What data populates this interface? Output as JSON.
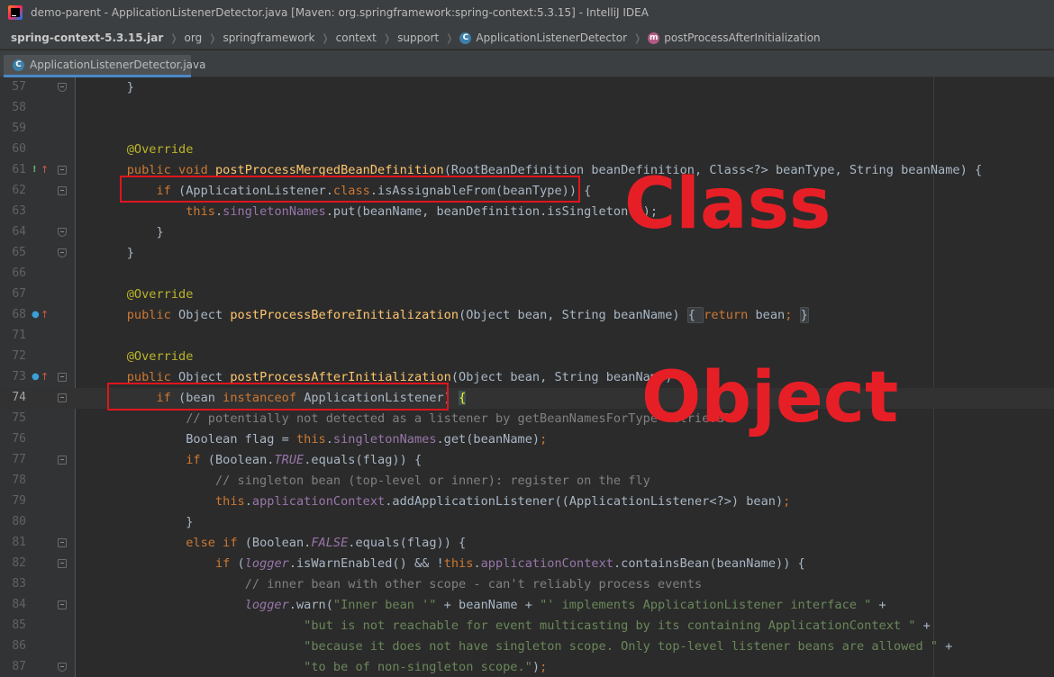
{
  "window": {
    "title": "demo-parent - ApplicationListenerDetector.java [Maven: org.springframework:spring-context:5.3.15] - IntelliJ IDEA"
  },
  "breadcrumbs": [
    {
      "label": "spring-context-5.3.15.jar",
      "icon": "jar"
    },
    {
      "label": "org",
      "icon": "none"
    },
    {
      "label": "springframework",
      "icon": "none"
    },
    {
      "label": "context",
      "icon": "none"
    },
    {
      "label": "support",
      "icon": "none"
    },
    {
      "label": "ApplicationListenerDetector",
      "icon": "class-icon"
    },
    {
      "label": "postProcessAfterInitialization",
      "icon": "method-icon"
    }
  ],
  "tab": {
    "label": "ApplicationListenerDetector.java",
    "icon": "class-icon"
  },
  "editor": {
    "current_line": "74",
    "lines": [
      {
        "n": "57",
        "gutter": "",
        "fold": "end",
        "segs": [
          [
            "    }",
            ""
          ]
        ]
      },
      {
        "n": "58",
        "gutter": "",
        "fold": "",
        "segs": []
      },
      {
        "n": "59",
        "gutter": "",
        "fold": "",
        "segs": []
      },
      {
        "n": "60",
        "gutter": "",
        "fold": "",
        "segs": [
          [
            "    ",
            ""
          ],
          [
            "@Override",
            "an"
          ]
        ]
      },
      {
        "n": "61",
        "gutter": "override-warn",
        "fold": "start",
        "segs": [
          [
            "    ",
            ""
          ],
          [
            "public void ",
            "kw"
          ],
          [
            "postProcessMergedBeanDefinition",
            "fn"
          ],
          [
            "(RootBeanDefinition beanDefinition, Class<?> beanType, String beanName) {",
            ""
          ]
        ]
      },
      {
        "n": "62",
        "gutter": "",
        "fold": "start",
        "segs": [
          [
            "        ",
            ""
          ],
          [
            "if ",
            "kw"
          ],
          [
            "(ApplicationListener.",
            ""
          ],
          [
            "class",
            "kw"
          ],
          [
            ".isAssignableFrom(beanType)) {",
            ""
          ]
        ]
      },
      {
        "n": "63",
        "gutter": "",
        "fold": "",
        "segs": [
          [
            "            ",
            ""
          ],
          [
            "this",
            "kw"
          ],
          [
            ".",
            ""
          ],
          [
            "singletonNames",
            "fd"
          ],
          [
            ".put(beanName, beanDefinition.isSingleton());",
            ""
          ]
        ]
      },
      {
        "n": "64",
        "gutter": "",
        "fold": "end",
        "segs": [
          [
            "        }",
            ""
          ]
        ]
      },
      {
        "n": "65",
        "gutter": "",
        "fold": "end",
        "segs": [
          [
            "    }",
            ""
          ]
        ]
      },
      {
        "n": "66",
        "gutter": "",
        "fold": "",
        "segs": []
      },
      {
        "n": "67",
        "gutter": "",
        "fold": "",
        "segs": [
          [
            "    ",
            ""
          ],
          [
            "@Override",
            "an"
          ]
        ]
      },
      {
        "n": "68",
        "gutter": "override",
        "fold": "",
        "segs": [
          [
            "    ",
            ""
          ],
          [
            "public ",
            "kw"
          ],
          [
            "Object ",
            ""
          ],
          [
            "postProcessBeforeInitialization",
            "fn"
          ],
          [
            "(Object bean, String beanName)",
            ""
          ],
          [
            " ",
            ""
          ],
          [
            "{ ",
            "fold-box"
          ],
          [
            "return ",
            "kw"
          ],
          [
            "bean",
            ""
          ],
          [
            "; ",
            "kw"
          ],
          [
            "}",
            "fold-box"
          ]
        ]
      },
      {
        "n": "71",
        "gutter": "",
        "fold": "",
        "segs": []
      },
      {
        "n": "72",
        "gutter": "",
        "fold": "",
        "segs": [
          [
            "    ",
            ""
          ],
          [
            "@Override",
            "an"
          ]
        ]
      },
      {
        "n": "73",
        "gutter": "override",
        "fold": "start",
        "segs": [
          [
            "    ",
            ""
          ],
          [
            "public ",
            "kw"
          ],
          [
            "Object ",
            ""
          ],
          [
            "postProcessAfterInitialization",
            "fn"
          ],
          [
            "(Object bean, String beanName) {",
            ""
          ]
        ]
      },
      {
        "n": "74",
        "gutter": "",
        "fold": "start",
        "segs": [
          [
            "        ",
            ""
          ],
          [
            "if ",
            "kw"
          ],
          [
            "(bean ",
            ""
          ],
          [
            "instanceof ",
            "kw"
          ],
          [
            "ApplicationListener) ",
            ""
          ],
          [
            "{",
            "brace-hl"
          ]
        ]
      },
      {
        "n": "75",
        "gutter": "",
        "fold": "",
        "segs": [
          [
            "            ",
            ""
          ],
          [
            "// potentially not detected as a listener by getBeanNamesForType retrieval",
            "cm"
          ]
        ]
      },
      {
        "n": "76",
        "gutter": "",
        "fold": "",
        "segs": [
          [
            "            Boolean flag = ",
            ""
          ],
          [
            "this",
            "kw"
          ],
          [
            ".",
            ""
          ],
          [
            "singletonNames",
            "fd"
          ],
          [
            ".get(beanName)",
            ""
          ],
          [
            ";",
            "kw"
          ]
        ]
      },
      {
        "n": "77",
        "gutter": "",
        "fold": "start",
        "segs": [
          [
            "            ",
            ""
          ],
          [
            "if ",
            "kw"
          ],
          [
            "(Boolean.",
            ""
          ],
          [
            "TRUE",
            "fd it"
          ],
          [
            ".equals(flag)) {",
            ""
          ]
        ]
      },
      {
        "n": "78",
        "gutter": "",
        "fold": "",
        "segs": [
          [
            "                ",
            ""
          ],
          [
            "// singleton bean (top-level or inner): register on the fly",
            "cm"
          ]
        ]
      },
      {
        "n": "79",
        "gutter": "",
        "fold": "",
        "segs": [
          [
            "                ",
            ""
          ],
          [
            "this",
            "kw"
          ],
          [
            ".",
            ""
          ],
          [
            "applicationContext",
            "fd"
          ],
          [
            ".addApplicationListener((ApplicationListener<?>) bean)",
            ""
          ],
          [
            ";",
            "kw"
          ]
        ]
      },
      {
        "n": "80",
        "gutter": "",
        "fold": "",
        "segs": [
          [
            "            }",
            ""
          ]
        ]
      },
      {
        "n": "81",
        "gutter": "",
        "fold": "start",
        "segs": [
          [
            "            ",
            ""
          ],
          [
            "else if ",
            "kw"
          ],
          [
            "(Boolean.",
            ""
          ],
          [
            "FALSE",
            "fd it"
          ],
          [
            ".equals(flag)) {",
            ""
          ]
        ]
      },
      {
        "n": "82",
        "gutter": "",
        "fold": "start",
        "segs": [
          [
            "                ",
            ""
          ],
          [
            "if ",
            "kw"
          ],
          [
            "(",
            ""
          ],
          [
            "logger",
            "fd it"
          ],
          [
            ".isWarnEnabled() && !",
            ""
          ],
          [
            "this",
            "kw"
          ],
          [
            ".",
            ""
          ],
          [
            "applicationContext",
            "fd"
          ],
          [
            ".containsBean(beanName)) {",
            ""
          ]
        ]
      },
      {
        "n": "83",
        "gutter": "",
        "fold": "",
        "segs": [
          [
            "                    ",
            ""
          ],
          [
            "// inner bean with other scope - can't reliably process events",
            "cm"
          ]
        ]
      },
      {
        "n": "84",
        "gutter": "",
        "fold": "start",
        "segs": [
          [
            "                    ",
            ""
          ],
          [
            "logger",
            "fd it"
          ],
          [
            ".warn(",
            ""
          ],
          [
            "\"Inner bean '\"",
            "str"
          ],
          [
            " + beanName + ",
            ""
          ],
          [
            "\"' implements ApplicationListener interface \"",
            "str"
          ],
          [
            " +",
            ""
          ]
        ]
      },
      {
        "n": "85",
        "gutter": "",
        "fold": "",
        "segs": [
          [
            "                            ",
            ""
          ],
          [
            "\"but is not reachable for event multicasting by its containing ApplicationContext \"",
            "str"
          ],
          [
            " +",
            ""
          ]
        ]
      },
      {
        "n": "86",
        "gutter": "",
        "fold": "",
        "segs": [
          [
            "                            ",
            ""
          ],
          [
            "\"because it does not have singleton scope. Only top-level listener beans are allowed \"",
            "str"
          ],
          [
            " +",
            ""
          ]
        ]
      },
      {
        "n": "87",
        "gutter": "",
        "fold": "end",
        "segs": [
          [
            "                            ",
            ""
          ],
          [
            "\"to be of non-singleton scope.\"",
            "str"
          ],
          [
            ")",
            ""
          ],
          [
            ";",
            "kw"
          ]
        ]
      }
    ]
  },
  "annotations": {
    "class_label": "Class",
    "object_label": "Object",
    "color": "#e61f26"
  },
  "colors": {
    "keyword": "#cc7832",
    "annotation": "#bbb529",
    "method": "#ffc66d",
    "field": "#9876aa",
    "string": "#6a8759",
    "comment": "#808080",
    "text": "#a9b7c6"
  }
}
